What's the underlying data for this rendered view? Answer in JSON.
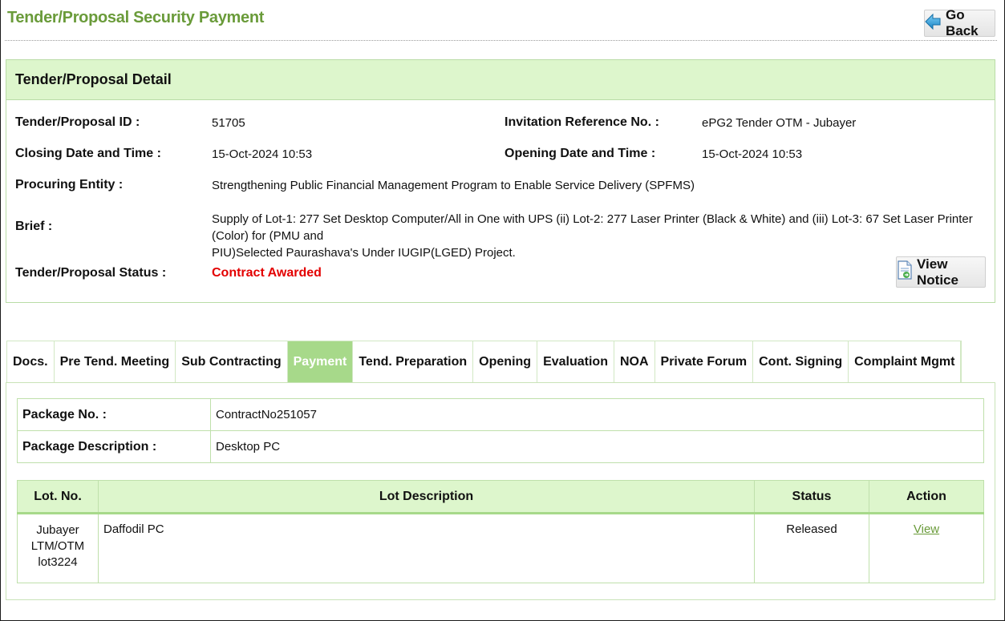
{
  "header": {
    "title": "Tender/Proposal Security Payment",
    "go_back_label": "Go Back"
  },
  "detail": {
    "heading": "Tender/Proposal Detail",
    "tender_id_label": "Tender/Proposal ID :",
    "tender_id": "51705",
    "invitation_ref_label": "Invitation Reference No. :",
    "invitation_ref": "ePG2 Tender OTM - Jubayer",
    "closing_label": "Closing Date and Time :",
    "closing": "15-Oct-2024 10:53",
    "opening_label": "Opening Date and Time :",
    "opening": "15-Oct-2024 10:53",
    "entity_label": "Procuring Entity :",
    "entity": "Strengthening Public Financial Management Program to Enable Service Delivery (SPFMS)",
    "brief_label": "Brief :",
    "brief_line1": "Supply of Lot-1: 277 Set Desktop Computer/All in One with UPS (ii) Lot-2: 277 Laser Printer (Black & White) and (iii) Lot-3: 67 Set Laser Printer (Color) for (PMU and",
    "brief_line2": "PIU)Selected Paurashava's Under IUGIP(LGED) Project.",
    "status_label": "Tender/Proposal Status :",
    "status": "Contract Awarded",
    "status_color": "#e30000",
    "view_notice_label": "View Notice"
  },
  "tabs": [
    {
      "label": "Docs."
    },
    {
      "label": "Pre Tend. Meeting"
    },
    {
      "label": "Sub Contracting"
    },
    {
      "label": "Payment",
      "active": true
    },
    {
      "label": "Tend. Preparation"
    },
    {
      "label": "Opening"
    },
    {
      "label": "Evaluation"
    },
    {
      "label": "NOA"
    },
    {
      "label": "Private Forum"
    },
    {
      "label": "Cont. Signing"
    },
    {
      "label": "Complaint Mgmt"
    }
  ],
  "package": {
    "no_label": "Package No. :",
    "no": "ContractNo251057",
    "desc_label": "Package Description :",
    "desc": "Desktop PC"
  },
  "lots": {
    "headers": [
      "Lot. No.",
      "Lot Description",
      "Status",
      "Action"
    ],
    "rows": [
      {
        "lot_no_lines": [
          "Jubayer",
          "LTM/OTM",
          "lot3224"
        ],
        "description": "Daffodil PC",
        "status": "Released",
        "action": "View"
      }
    ]
  },
  "colors": {
    "accent_green": "#6a9b3a",
    "header_bg": "#ddf6cc",
    "active_tab": "#a7d98a"
  },
  "icons": {
    "go_back": "back-arrow-icon",
    "view_notice": "document-icon"
  }
}
